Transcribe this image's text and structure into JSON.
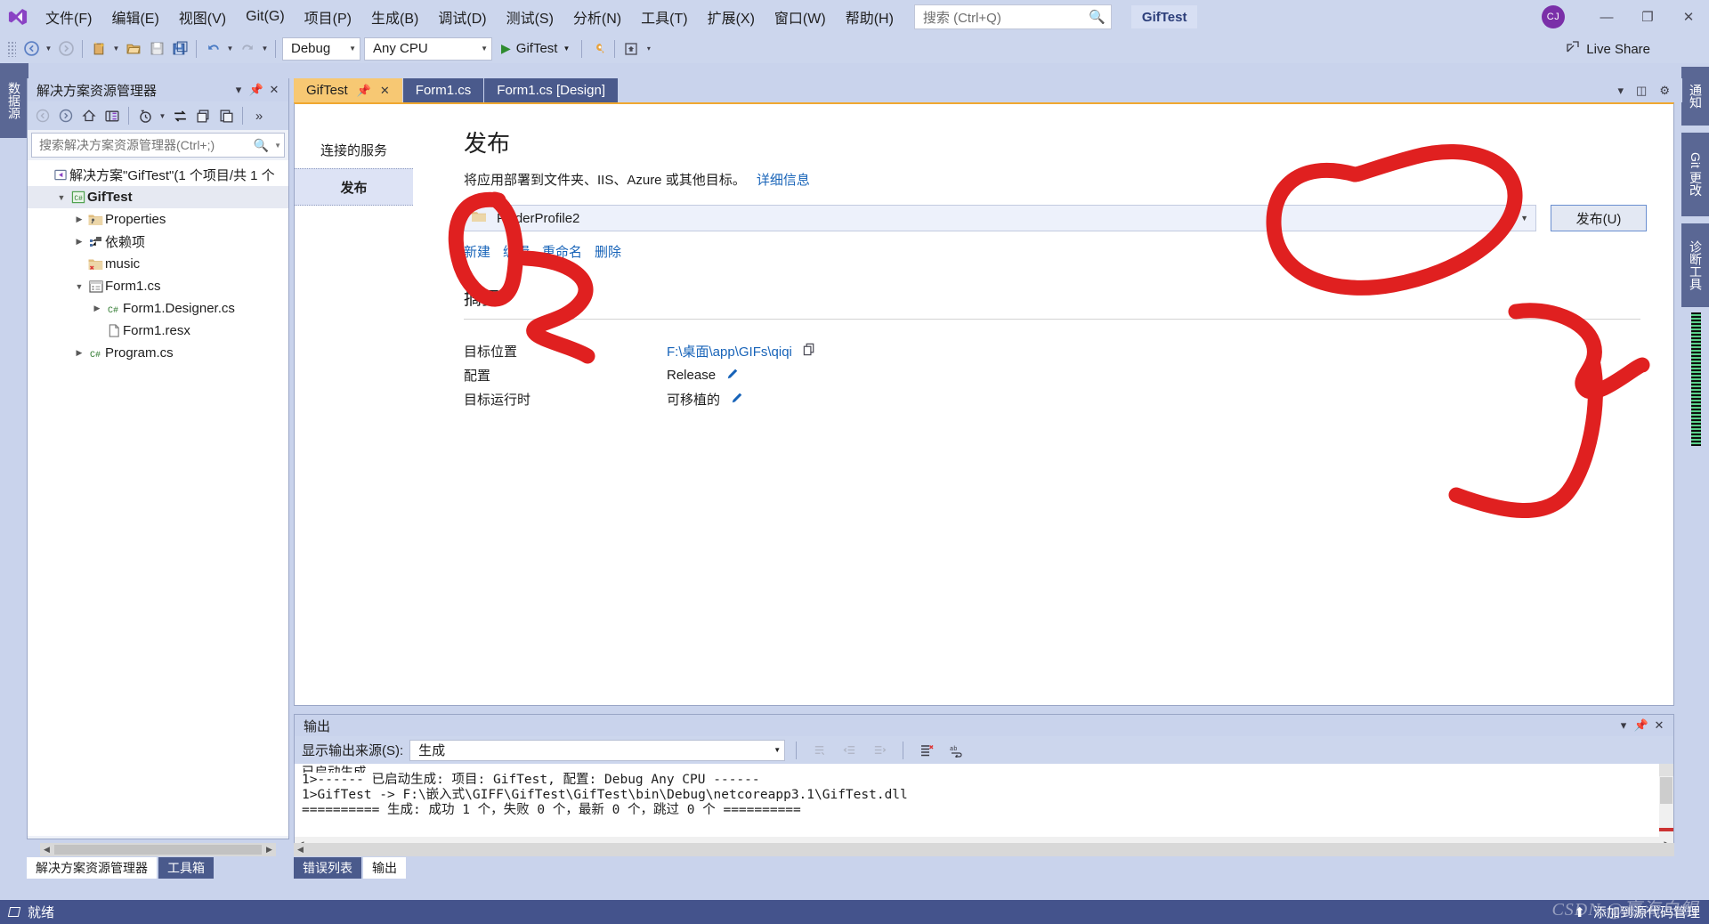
{
  "app": {
    "project_chip": "GifTest",
    "avatar_initials": "CJ"
  },
  "menu": {
    "items": [
      {
        "label": "文件(F)"
      },
      {
        "label": "编辑(E)"
      },
      {
        "label": "视图(V)"
      },
      {
        "label": "Git(G)"
      },
      {
        "label": "项目(P)"
      },
      {
        "label": "生成(B)"
      },
      {
        "label": "调试(D)"
      },
      {
        "label": "测试(S)"
      },
      {
        "label": "分析(N)"
      },
      {
        "label": "工具(T)"
      },
      {
        "label": "扩展(X)"
      },
      {
        "label": "窗口(W)"
      },
      {
        "label": "帮助(H)"
      }
    ]
  },
  "search": {
    "placeholder": "搜索 (Ctrl+Q)",
    "icon": "search-icon"
  },
  "window_controls": {
    "minimize": "—",
    "restore": "❐",
    "close": "✕"
  },
  "toolbar": {
    "configuration": "Debug",
    "platform": "Any CPU",
    "startup_project": "GifTest",
    "live_share": "Live Share"
  },
  "left_dock": {
    "tabs": [
      "数据源"
    ]
  },
  "right_dock": {
    "tabs": [
      "通知",
      "Git 更改",
      "诊断工具"
    ]
  },
  "solution_explorer": {
    "title": "解决方案资源管理器",
    "search_placeholder": "搜索解决方案资源管理器(Ctrl+;)",
    "tree": [
      {
        "depth": 0,
        "arrow": "none",
        "icon": "solution-icon",
        "label": "解决方案\"GifTest\"(1 个项目/共 1 个",
        "bold": false
      },
      {
        "depth": 1,
        "arrow": "down",
        "icon": "csharp-project-icon",
        "label": "GifTest",
        "bold": true
      },
      {
        "depth": 2,
        "arrow": "right",
        "icon": "properties-folder-icon",
        "label": "Properties",
        "bold": false
      },
      {
        "depth": 2,
        "arrow": "right",
        "icon": "dependencies-icon",
        "label": "依赖项",
        "bold": false
      },
      {
        "depth": 2,
        "arrow": "none",
        "icon": "excluded-folder-icon",
        "label": "music",
        "bold": false
      },
      {
        "depth": 2,
        "arrow": "down",
        "icon": "form-icon",
        "label": "Form1.cs",
        "bold": false
      },
      {
        "depth": 3,
        "arrow": "right",
        "icon": "csharp-file-icon",
        "label": "Form1.Designer.cs",
        "bold": false
      },
      {
        "depth": 3,
        "arrow": "none",
        "icon": "resx-file-icon",
        "label": "Form1.resx",
        "bold": false
      },
      {
        "depth": 2,
        "arrow": "right",
        "icon": "csharp-file-icon",
        "label": "Program.cs",
        "bold": false
      }
    ]
  },
  "document_tabs": [
    {
      "label": "GifTest",
      "active": true,
      "pinned": true,
      "closable": true
    },
    {
      "label": "Form1.cs",
      "active": false,
      "pinned": false,
      "closable": false
    },
    {
      "label": "Form1.cs [Design]",
      "active": false,
      "pinned": false,
      "closable": false
    }
  ],
  "publish": {
    "nav": [
      {
        "label": "连接的服务",
        "active": false
      },
      {
        "label": "发布",
        "active": true
      }
    ],
    "heading": "发布",
    "subtitle": "将应用部署到文件夹、IIS、Azure 或其他目标。",
    "more_info_link": "详细信息",
    "profile_name": "FolderProfile2",
    "publish_button": "发布(U)",
    "profile_links": [
      "新建",
      "编辑",
      "重命名",
      "删除"
    ],
    "summary_heading": "摘要",
    "summary_rows": [
      {
        "key": "目标位置",
        "value": "F:\\桌面\\app\\GIFs\\qiqi",
        "action": "copy-icon",
        "is_link": true
      },
      {
        "key": "配置",
        "value": "Release",
        "action": "edit-pencil-icon",
        "is_link": false
      },
      {
        "key": "目标运行时",
        "value": "可移植的",
        "action": "edit-pencil-icon",
        "is_link": false
      }
    ]
  },
  "output": {
    "title": "输出",
    "source_label": "显示输出来源(S):",
    "source_value": "生成",
    "lines": [
      "已启动生成…",
      "1>------ 已启动生成: 项目: GifTest, 配置: Debug Any CPU ------",
      "1>GifTest -> F:\\嵌入式\\GIFF\\GifTest\\GifTest\\bin\\Debug\\netcoreapp3.1\\GifTest.dll",
      "========== 生成: 成功 1 个，失败 0 个，最新 0 个，跳过 0 个 =========="
    ]
  },
  "bottom_docks": {
    "left": [
      {
        "label": "解决方案资源管理器",
        "active": false
      },
      {
        "label": "工具箱",
        "active": true
      }
    ],
    "right": [
      {
        "label": "错误列表",
        "active": true
      },
      {
        "label": "输出",
        "active": false
      }
    ]
  },
  "statusbar": {
    "ready": "就绪",
    "source_control": "添加到源代码管理",
    "watermark": "CSDN @嬴海白鲲"
  },
  "colors": {
    "title_bar": "#ccd6ed",
    "status_bar": "#44538c",
    "accent_tab": "#f7c873",
    "link": "#1763b8",
    "ink_red": "#e02020",
    "avatar": "#7a2fa8"
  }
}
